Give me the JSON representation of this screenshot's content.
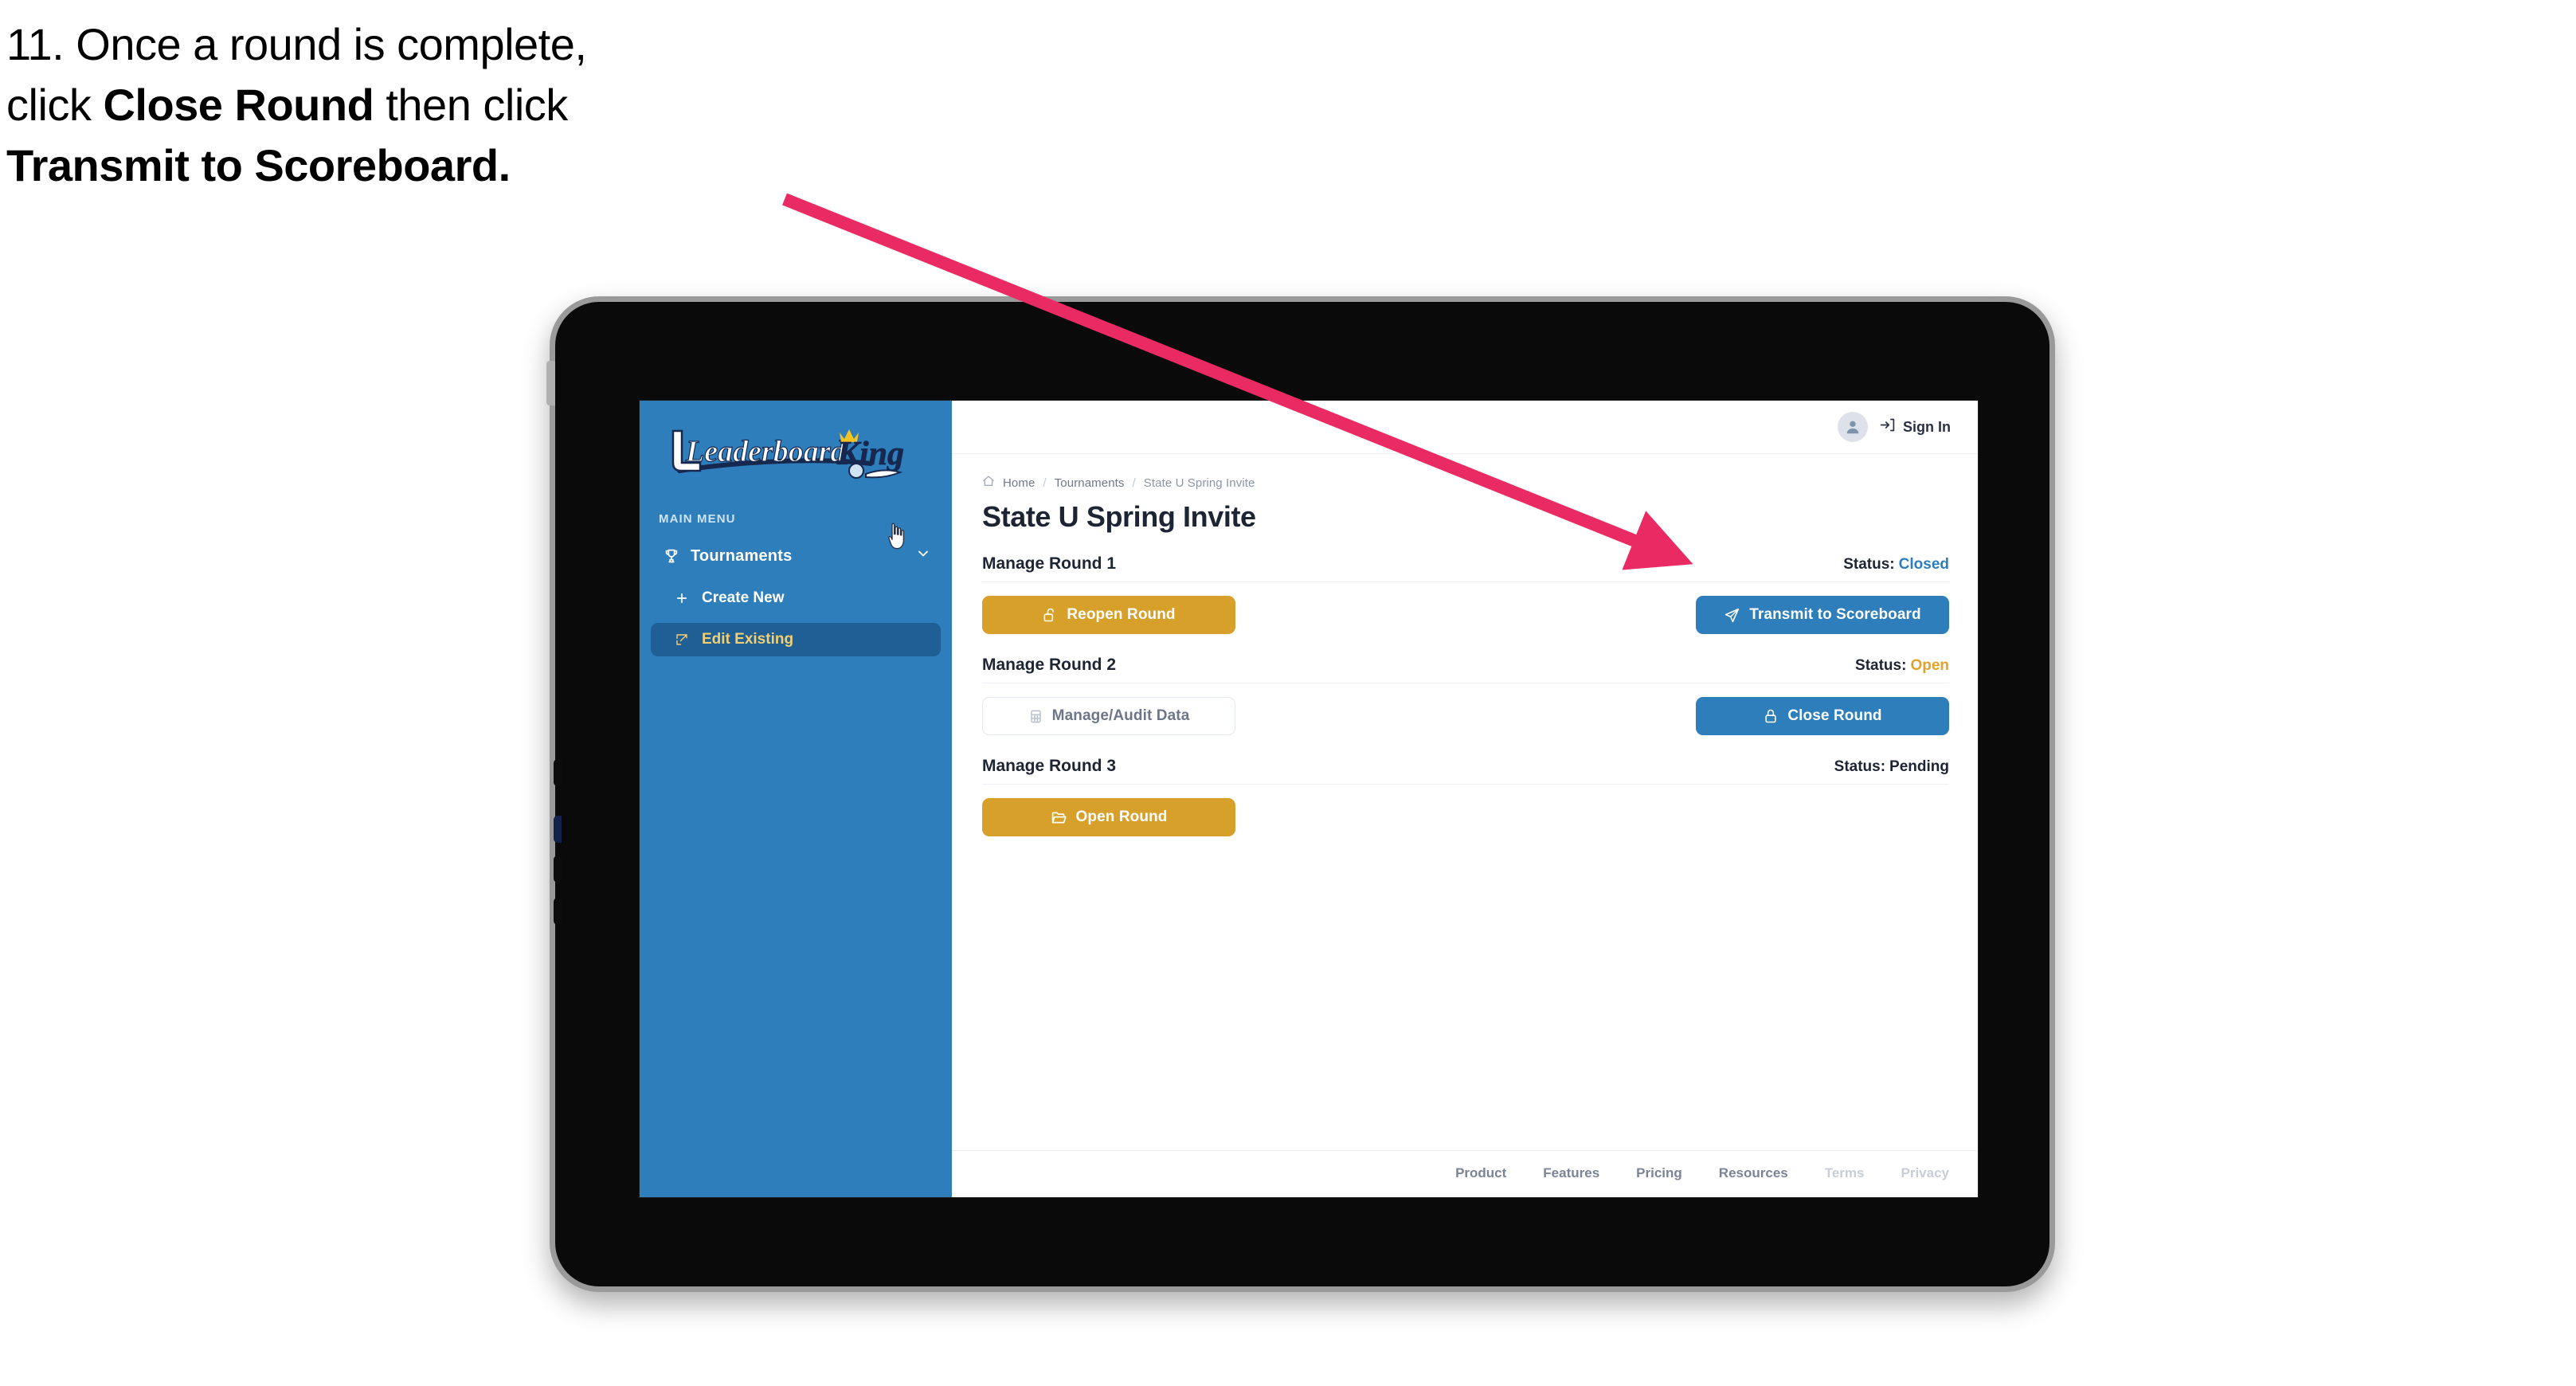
{
  "instruction": {
    "number": "11.",
    "part1": "Once a round is complete,",
    "part2_pre": "click ",
    "part2_bold": "Close Round",
    "part2_post": " then click",
    "part3_bold": "Transmit to Scoreboard.",
    "full_text": "11. Once a round is complete, click Close Round then click Transmit to Scoreboard.",
    "arrow_color": "#ea2a63"
  },
  "device": {
    "type": "tablet",
    "frame_color": "#0a0a0a",
    "bezel_color": "#9a9a9a"
  },
  "sidebar": {
    "brand": {
      "word_one": "Leaderboard",
      "word_two": "King",
      "icon": "golf-club-icon",
      "crown_icon": "crown-icon"
    },
    "section_label": "MAIN MENU",
    "items": [
      {
        "label": "Tournaments",
        "icon": "trophy-icon",
        "chevron": "chevron-down-icon",
        "active": false
      },
      {
        "label": "Create New",
        "icon": "plus-icon",
        "active": false
      },
      {
        "label": "Edit Existing",
        "icon": "pencil-square-icon",
        "active": true
      }
    ],
    "background": "#2e7ebb",
    "active_background": "#1f5f95",
    "active_text": "#f2cf72",
    "cursor": "pointer-hand-cursor"
  },
  "topbar": {
    "avatar_icon": "user-avatar-icon",
    "signin_icon": "sign-in-icon",
    "signin_label": "Sign In"
  },
  "breadcrumb": {
    "home_icon": "home-icon",
    "items": [
      "Home",
      "Tournaments",
      "State U Spring Invite"
    ],
    "separator": "/"
  },
  "page": {
    "title": "State U Spring Invite"
  },
  "rounds": [
    {
      "name": "Manage Round 1",
      "status_label": "Status:",
      "status_value": "Closed",
      "status_color": "#2e7ebb",
      "left_button": {
        "label": "Reopen Round",
        "icon": "unlock-icon",
        "style": "gold"
      },
      "right_button": {
        "label": "Transmit to Scoreboard",
        "icon": "paper-plane-icon",
        "style": "blue"
      }
    },
    {
      "name": "Manage Round 2",
      "status_label": "Status:",
      "status_value": "Open",
      "status_color": "#e0a32e",
      "left_button": {
        "label": "Manage/Audit Data",
        "icon": "table-grid-icon",
        "style": "ghost"
      },
      "right_button": {
        "label": "Close Round",
        "icon": "lock-icon",
        "style": "blue"
      }
    },
    {
      "name": "Manage Round 3",
      "status_label": "Status:",
      "status_value": "Pending",
      "status_color": "#1d2433",
      "left_button": {
        "label": "Open Round",
        "icon": "folder-open-icon",
        "style": "gold"
      },
      "right_button": null
    }
  ],
  "footer": {
    "links": [
      {
        "label": "Product",
        "muted": false
      },
      {
        "label": "Features",
        "muted": false
      },
      {
        "label": "Pricing",
        "muted": false
      },
      {
        "label": "Resources",
        "muted": false
      },
      {
        "label": "Terms",
        "muted": true
      },
      {
        "label": "Privacy",
        "muted": true
      }
    ]
  }
}
